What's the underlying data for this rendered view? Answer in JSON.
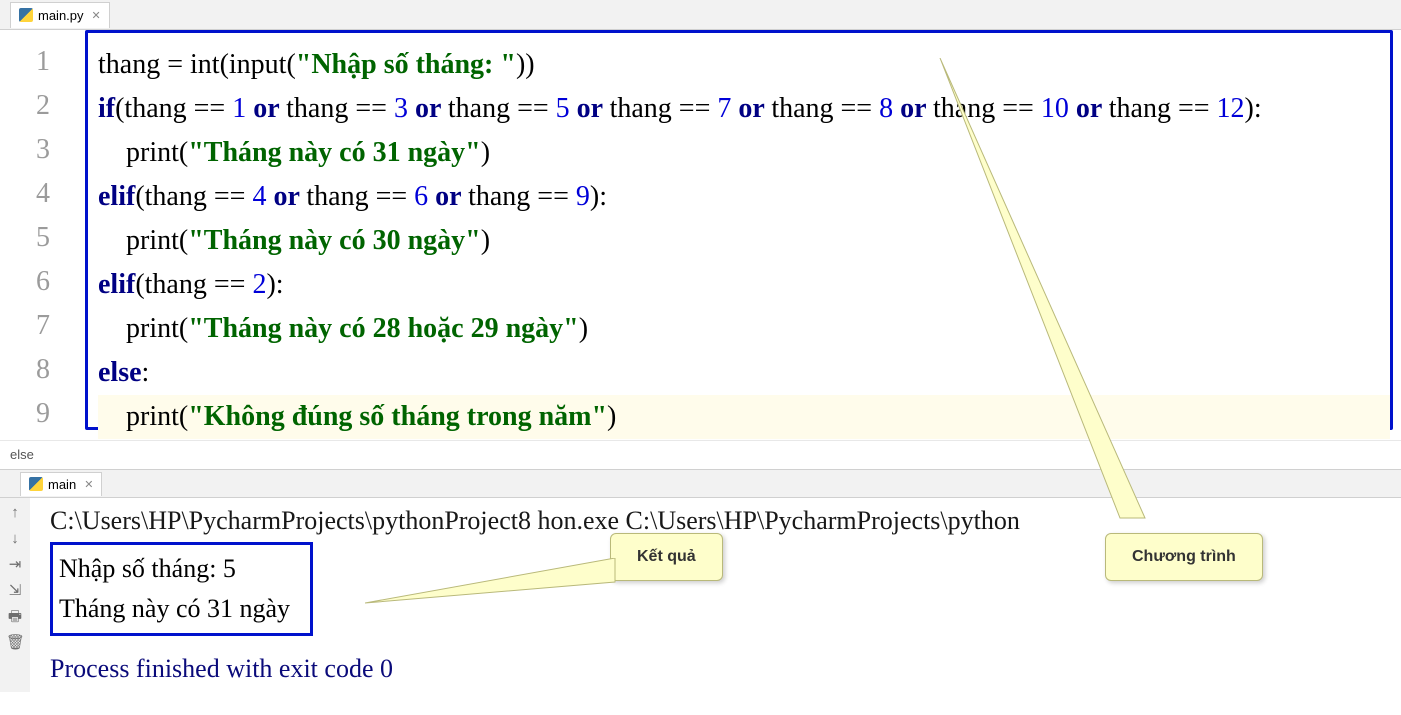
{
  "tab": {
    "filename": "main.py"
  },
  "gutter": [
    "1",
    "2",
    "3",
    "4",
    "5",
    "6",
    "7",
    "8",
    "9"
  ],
  "code": {
    "l1_a": "thang = ",
    "l1_b": "int",
    "l1_c": "(input(",
    "l1_str": "\"Nhập số tháng: \"",
    "l1_d": "))",
    "l2_if": "if",
    "l2_a": "(thang == ",
    "n1": "1",
    "l2_or": " or ",
    "l2_b": "thang == ",
    "n3": "3",
    "n5": "5",
    "n7": "7",
    "n8": "8",
    "n10": "10",
    "n12": "12",
    "l2_end": "):",
    "l3_a": "    ",
    "l3_p": "print",
    "l3_b": "(",
    "l3_str": "\"Tháng này có 31 ngày\"",
    "l3_c": ")",
    "l4_elif": "elif",
    "l4_a": "(thang == ",
    "n4": "4",
    "n6": "6",
    "n9": "9",
    "l4_end": "):",
    "l5_str": "\"Tháng này có 30 ngày\"",
    "l6_a": "(thang == ",
    "n2": "2",
    "l6_end": "):",
    "l7_str": "\"Tháng này có 28 hoặc 29 ngày\"",
    "l8_else": "else",
    "l8_c": ":",
    "l9_str": "\"Không đúng số tháng trong năm\""
  },
  "breadcrumb": "else",
  "runTab": "main",
  "console": {
    "cmd": "C:\\Users\\HP\\PycharmProjects\\pythonProject8                               hon.exe C:\\Users\\HP\\PycharmProjects\\python",
    "out1": "Nhập số tháng: 5",
    "out2": "Tháng này có 31 ngày",
    "exit": "Process finished with exit code 0"
  },
  "callouts": {
    "result": "Kết quả",
    "program": "Chương trình"
  }
}
